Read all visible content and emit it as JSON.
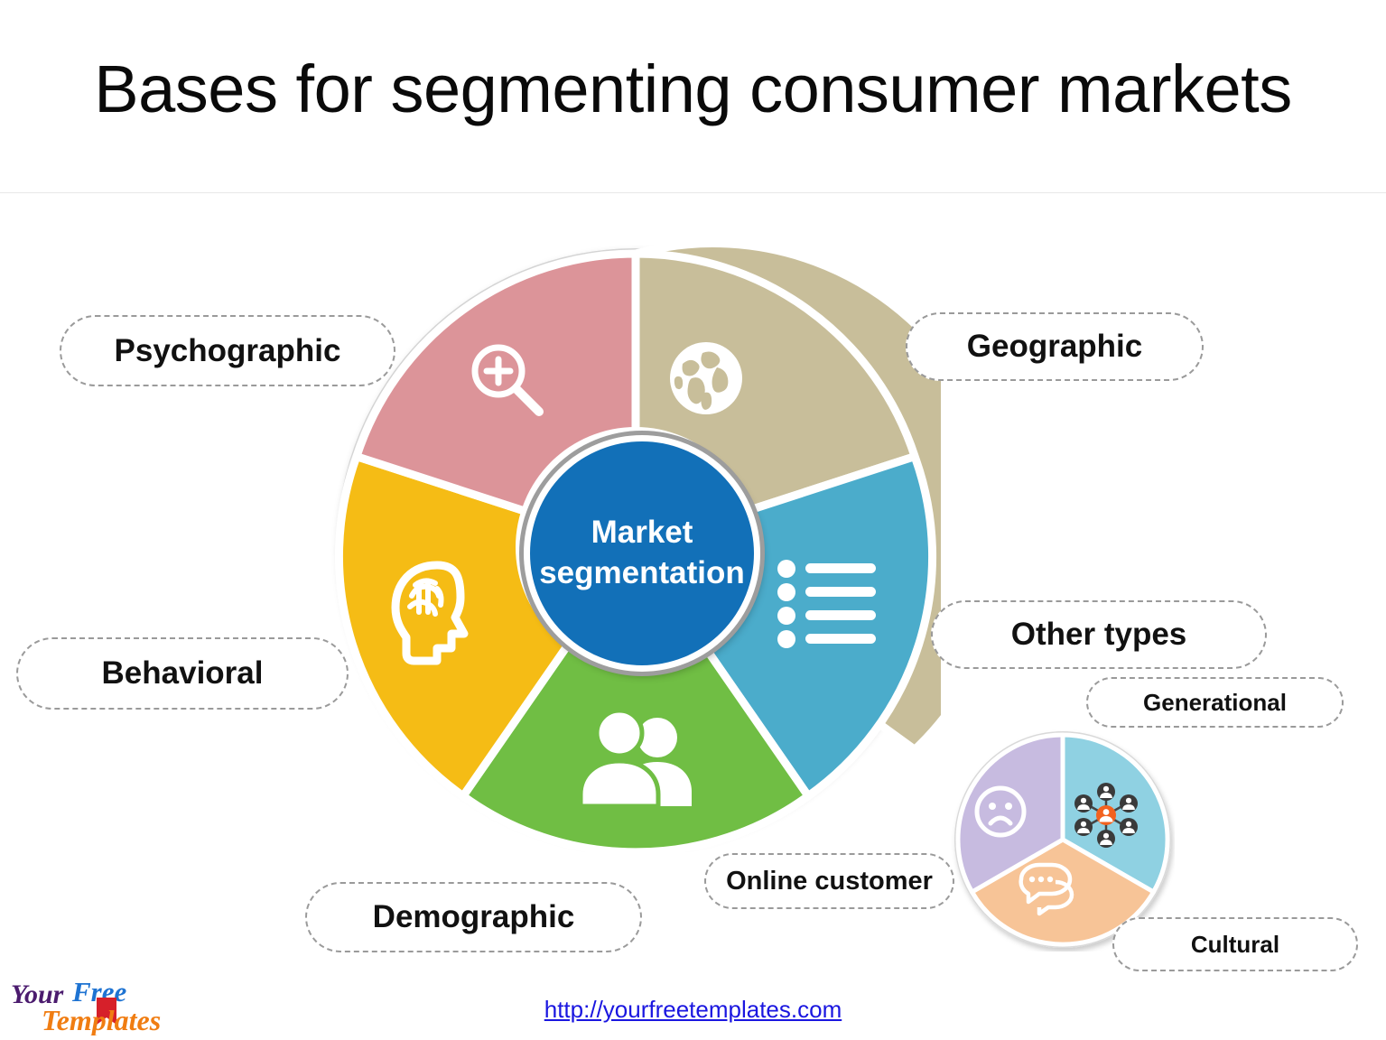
{
  "slide": {
    "title": "Bases for segmenting consumer markets"
  },
  "center": {
    "line1": "Market",
    "line2": "segmentation",
    "color": "#1270B8"
  },
  "labels": {
    "psychographic": "Psychographic",
    "geographic": "Geographic",
    "behavioral": "Behavioral",
    "other_types": "Other types",
    "generational": "Generational",
    "demographic": "Demographic",
    "online_customer": "Online customer",
    "cultural": "Cultural"
  },
  "footer": {
    "url": "http://yourfreetemplates.com",
    "logo_word1": "Your",
    "logo_word2": "Free",
    "logo_word3": "Templates",
    "logo_color1": "#4B1B6E",
    "logo_color2": "#1E73D2",
    "logo_color3": "#F07D12",
    "url_color": "#1a16e0"
  },
  "chart_data": [
    {
      "type": "pie",
      "name": "main-segmentation-donut",
      "title": "Market segmentation",
      "categories": [
        "Geographic",
        "Other types",
        "Demographic",
        "Behavioral",
        "Psychographic"
      ],
      "values": [
        20,
        20,
        20,
        20,
        20
      ],
      "start_angle_deg": 0,
      "colors": [
        "#C8BE9A",
        "#4BACCB",
        "#70BE44",
        "#F5BC15",
        "#DC9499"
      ],
      "icons": [
        "globe-icon",
        "bulleted-list-icon",
        "two-people-icon",
        "head-brain-icon",
        "magnifier-plus-icon"
      ],
      "inner_hole_ratio": 0.37,
      "legend": "outside-callout-pills",
      "grid": false
    },
    {
      "type": "pie",
      "name": "other-types-small-pie",
      "title": "Other types",
      "categories": [
        "Generational",
        "Cultural",
        "Online customer"
      ],
      "values": [
        33.33,
        33.33,
        33.33
      ],
      "start_angle_deg": 0,
      "colors": [
        "#8FD1E2",
        "#F7C497",
        "#C7BBE0"
      ],
      "icons": [
        "people-network-icon",
        "chat-bubbles-icon",
        "sad-face-icon"
      ],
      "inner_hole_ratio": 0,
      "legend": "outside-callout-pills",
      "grid": false
    }
  ]
}
